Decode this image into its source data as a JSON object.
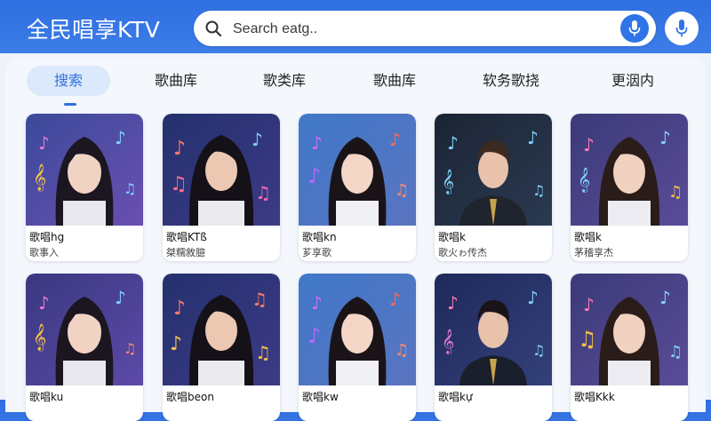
{
  "header": {
    "app_title": "全民唱享KTV",
    "search_placeholder": "Search eatg..",
    "colors": {
      "brand": "#2f6fe0",
      "accent": "#2f74e6"
    }
  },
  "tabs": [
    {
      "label": "搜索",
      "active": true
    },
    {
      "label": "歌曲库"
    },
    {
      "label": "歌类库"
    },
    {
      "label": "歌曲库"
    },
    {
      "label": "软务歌挠"
    },
    {
      "label": "更洇内"
    }
  ],
  "cards": [
    {
      "title": "歌唱hg",
      "subtitle": "歌事入",
      "icon": "female-singer-portrait"
    },
    {
      "title": "歌唱KTß",
      "subtitle": "桀糯敘臆",
      "icon": "male-singer-portrait"
    },
    {
      "title": "歌唱kn",
      "subtitle": "芗享歌",
      "icon": "female-singer-portrait"
    },
    {
      "title": "歌唱k",
      "subtitle": "歌火ゎ传杰",
      "icon": "male-singer-portrait"
    },
    {
      "title": "歌唱k",
      "subtitle": "茅稽享杰",
      "icon": "female-singer-portrait"
    },
    {
      "title": "歌唱ku",
      "subtitle": "",
      "icon": "female-singer-portrait"
    },
    {
      "title": "歌唱beon",
      "subtitle": "",
      "icon": "male-singer-portrait"
    },
    {
      "title": "歌唱kw",
      "subtitle": "",
      "icon": "female-singer-portrait"
    },
    {
      "title": "歌唱kự",
      "subtitle": "",
      "icon": "male-singer-portrait"
    },
    {
      "title": "歌唱Kkk",
      "subtitle": "",
      "icon": "female-singer-portrait"
    }
  ]
}
